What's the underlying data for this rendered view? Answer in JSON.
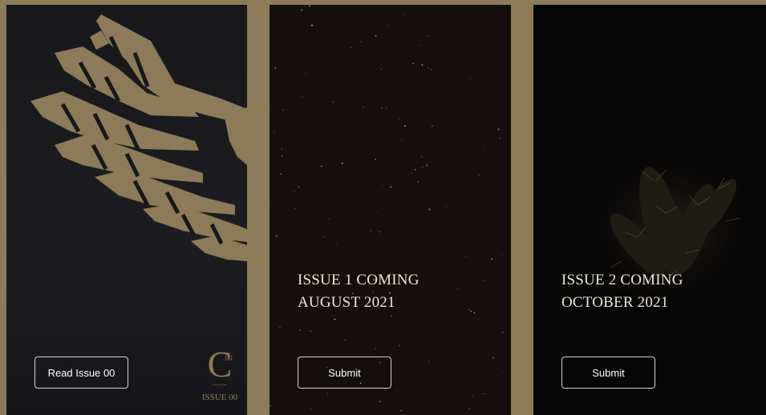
{
  "colors": {
    "frame": "#8c7a58",
    "accent_gold": "#8c7a58",
    "text": "#ece6d8"
  },
  "panels": [
    {
      "button_label": "Read Issue 00",
      "logo": {
        "letter": "C",
        "inner": "00",
        "tagline": "A Cup Of Tea",
        "issue": "ISSUE 00"
      }
    },
    {
      "heading_line1": "ISSUE 1 COMING",
      "heading_line2": "AUGUST 2021",
      "button_label": "Submit"
    },
    {
      "heading_line1": "ISSUE 2 COMING",
      "heading_line2": "OCTOBER 2021",
      "button_label": "Submit"
    }
  ]
}
